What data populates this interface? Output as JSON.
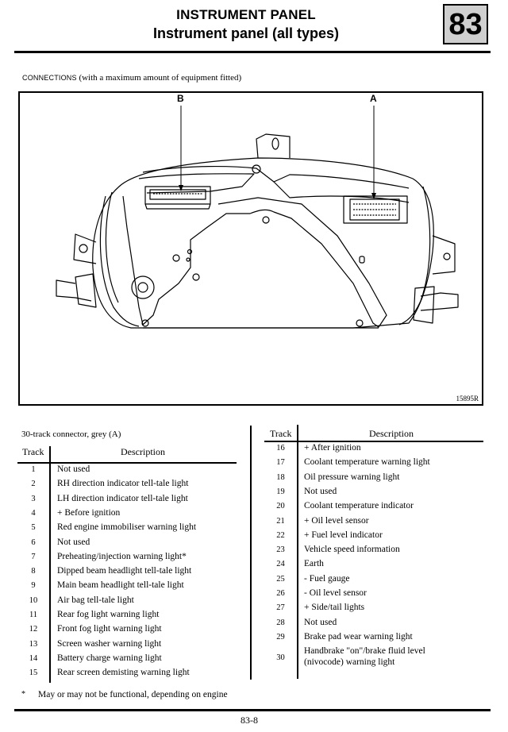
{
  "header": {
    "title": "INSTRUMENT PANEL",
    "subtitle": "Instrument panel (all types)",
    "chapter": "83"
  },
  "connections": {
    "label_smallcaps": "CONNECTIONS",
    "label_rest": "(with a maximum amount of equipment fitted)"
  },
  "diagram": {
    "label_b": "B",
    "label_a": "A",
    "figure_ref": "15895R"
  },
  "table_left": {
    "caption": "30-track connector, grey (A)",
    "headers": {
      "track": "Track",
      "description": "Description"
    },
    "rows": [
      {
        "track": "1",
        "description": "Not used"
      },
      {
        "track": "2",
        "description": "RH direction indicator tell-tale light"
      },
      {
        "track": "3",
        "description": "LH direction indicator tell-tale light"
      },
      {
        "track": "4",
        "description": "+ Before ignition"
      },
      {
        "track": "5",
        "description": "Red engine immobiliser warning light"
      },
      {
        "track": "6",
        "description": "Not used"
      },
      {
        "track": "7",
        "description": "Preheating/injection warning light*"
      },
      {
        "track": "8",
        "description": "Dipped beam headlight tell-tale light"
      },
      {
        "track": "9",
        "description": "Main beam headlight tell-tale light"
      },
      {
        "track": "10",
        "description": "Air bag tell-tale light"
      },
      {
        "track": "11",
        "description": "Rear fog light warning light"
      },
      {
        "track": "12",
        "description": "Front fog light warning light"
      },
      {
        "track": "13",
        "description": "Screen washer warning light"
      },
      {
        "track": "14",
        "description": "Battery charge warning light"
      },
      {
        "track": "15",
        "description": "Rear screen demisting warning light"
      }
    ]
  },
  "table_right": {
    "headers": {
      "track": "Track",
      "description": "Description"
    },
    "rows": [
      {
        "track": "16",
        "description": "+ After ignition"
      },
      {
        "track": "17",
        "description": "Coolant temperature warning light"
      },
      {
        "track": "18",
        "description": "Oil pressure warning light"
      },
      {
        "track": "19",
        "description": "Not used"
      },
      {
        "track": "20",
        "description": "Coolant temperature indicator"
      },
      {
        "track": "21",
        "description": "+ Oil level sensor"
      },
      {
        "track": "22",
        "description": "+ Fuel level indicator"
      },
      {
        "track": "23",
        "description": "Vehicle speed information"
      },
      {
        "track": "24",
        "description": "Earth"
      },
      {
        "track": "25",
        "description": "- Fuel gauge"
      },
      {
        "track": "26",
        "description": "- Oil level sensor"
      },
      {
        "track": "27",
        "description": "+ Side/tail lights"
      },
      {
        "track": "28",
        "description": "Not used"
      },
      {
        "track": "29",
        "description": "Brake pad wear warning light"
      },
      {
        "track": "30",
        "description": "Handbrake \"on\"/brake fluid level",
        "description_line2": "(nivocode) warning light"
      }
    ]
  },
  "footnote": {
    "marker": "*",
    "text": "May or may not be functional, depending on engine"
  },
  "footer": {
    "page_number": "83-8"
  }
}
